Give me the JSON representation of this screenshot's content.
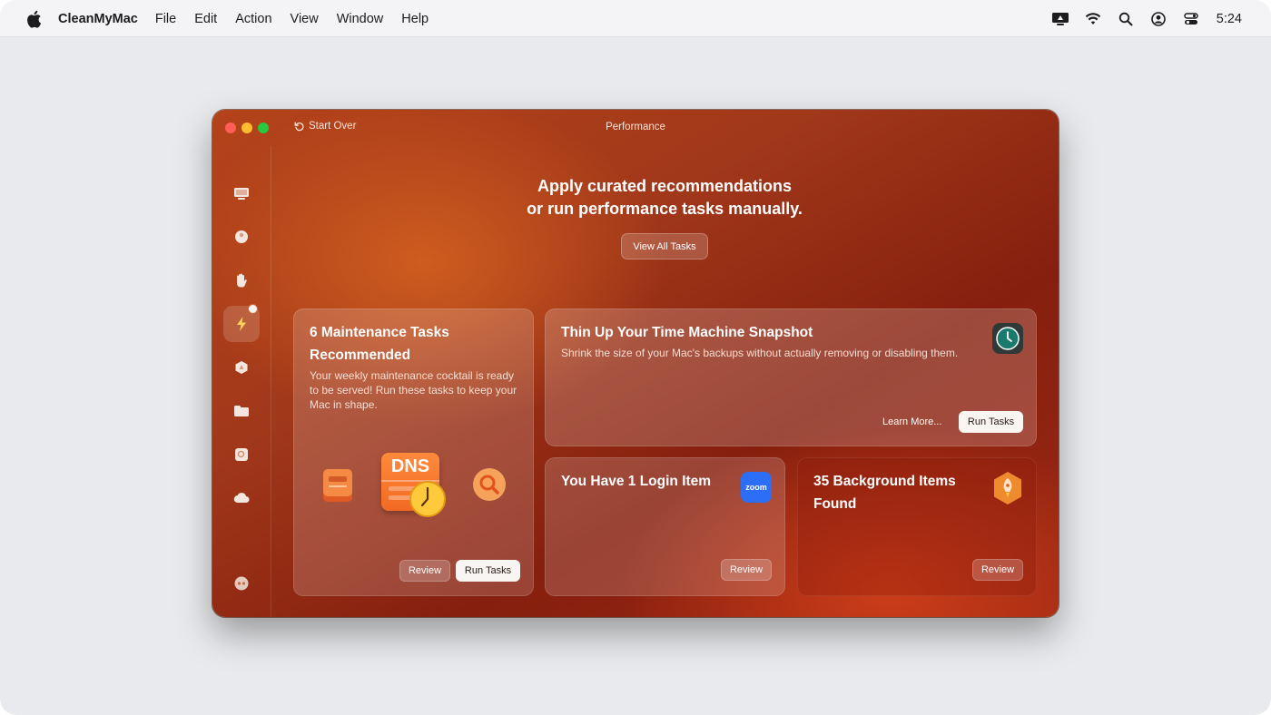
{
  "menubar": {
    "app_name": "CleanMyMac",
    "items": [
      "File",
      "Edit",
      "Action",
      "View",
      "Window",
      "Help"
    ],
    "clock": "5:24"
  },
  "window": {
    "title": "Performance",
    "start_over": "Start Over"
  },
  "headline": {
    "line1": "Apply curated recommendations",
    "line2": "or run performance tasks manually."
  },
  "view_all_label": "View All Tasks",
  "cards": {
    "maintenance": {
      "title_line1": "6 Maintenance Tasks",
      "title_line2": "Recommended",
      "desc": "Your weekly maintenance cocktail is ready to be served! Run these tasks to keep your Mac in shape.",
      "dns_label": "DNS",
      "review": "Review",
      "run": "Run Tasks"
    },
    "time_machine": {
      "title": "Thin Up Your Time Machine Snapshot",
      "desc": "Shrink the size of your Mac's backups without actually removing or disabling them.",
      "learn_more": "Learn More...",
      "run": "Run Tasks"
    },
    "login": {
      "title": "You Have 1 Login Item",
      "icon_text": "zoom",
      "review": "Review"
    },
    "background": {
      "title_line1": "35 Background Items",
      "title_line2": "Found",
      "review": "Review"
    }
  },
  "colors": {
    "accent_orange": "#d3622a",
    "window_dark": "#861f0e",
    "zoom_blue": "#2d6ef6"
  }
}
